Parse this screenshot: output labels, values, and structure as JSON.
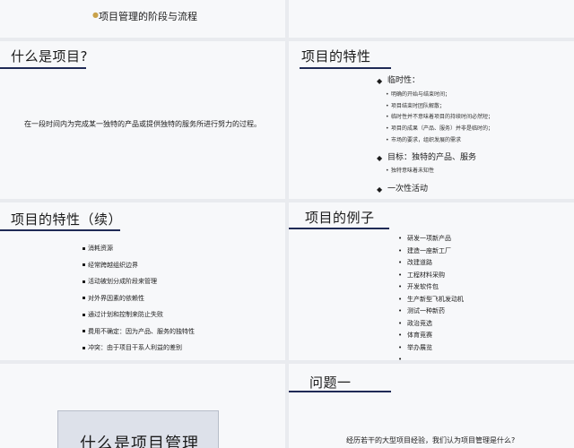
{
  "slide1": {
    "title": "项目管理的阶段与流程"
  },
  "slide3": {
    "title": "什么是项目?",
    "text": "在一段时间内为完成某一独特的产品或提供独特的服务所进行努力的过程。"
  },
  "slide4": {
    "title": "项目的特性",
    "groups": [
      {
        "label": "临时性：",
        "items": [
          "明确的开始与结束时间；",
          "项目结束时团队解散；",
          "临时性并不意味着项目的持续时间必然短；",
          "项目的成果（产品、服务）并非是临时的；",
          "市场的要求，组织发展的需求"
        ]
      },
      {
        "label": "目标：独特的产品、服务",
        "items": [
          "独特意味着未知性"
        ]
      },
      {
        "label": "一次性活动",
        "items": []
      }
    ]
  },
  "slide5": {
    "title": "项目的特性（续）",
    "items": [
      "消耗资源",
      "经常跨越组织边界",
      "活动被划分成阶段来管理",
      "对外界因素的依赖性",
      "通过计划和控制来防止失败",
      "费用不确定：因为产品、服务的独特性",
      "冲突：由于项目干系人利益的差别"
    ]
  },
  "slide6": {
    "title": "项目的例子",
    "items": [
      "研发一项新产品",
      "建造一座新工厂",
      "改建道路",
      "工程材料采购",
      "开发软件包",
      "生产新型飞机发动机",
      "测试一种新药",
      "政治竞选",
      "体育竞赛",
      "举办展览",
      "……"
    ]
  },
  "slide7": {
    "text": "什么是项目管理"
  },
  "slide8": {
    "title": "问题一",
    "text": "经历若干的大型项目经验，我们认为项目管理是什么?"
  },
  "bullets": {
    "diamond": "◆",
    "dot": "•"
  },
  "colors": {
    "rule": "#1f2a55",
    "accent": "#c9a24a",
    "background": "#f7f8fa"
  }
}
